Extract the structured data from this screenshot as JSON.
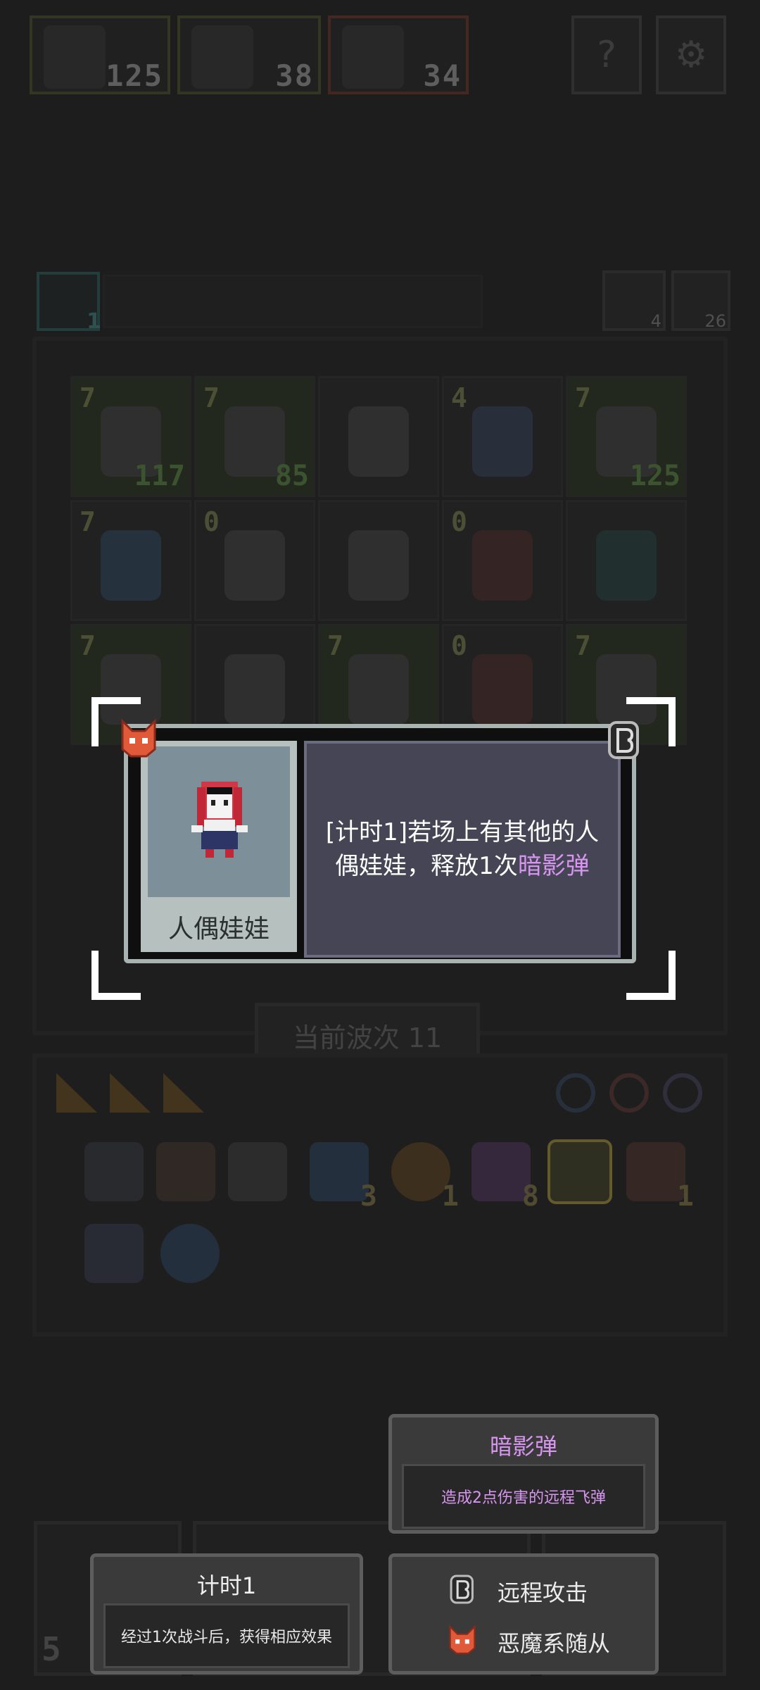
{
  "top_bar": {
    "hero_counts": [
      "125",
      "38",
      "34"
    ],
    "help_label": "?",
    "settings_label": "⚙"
  },
  "status": {
    "clock_value": "1",
    "refresh_count": "4",
    "key_count": "26"
  },
  "board": {
    "cells": [
      {
        "level": "7",
        "hp": "117"
      },
      {
        "level": "7",
        "hp": "85"
      },
      {
        "level": "",
        "hp": ""
      },
      {
        "level": "4",
        "hp": ""
      },
      {
        "level": "7",
        "hp": "125"
      },
      {
        "level": "7",
        "hp": ""
      },
      {
        "level": "0",
        "hp": ""
      },
      {
        "level": "",
        "hp": ""
      },
      {
        "level": "0",
        "hp": ""
      },
      {
        "level": "",
        "hp": ""
      },
      {
        "level": "7",
        "hp": ""
      },
      {
        "level": "",
        "hp": ""
      },
      {
        "level": "7",
        "hp": ""
      },
      {
        "level": "0",
        "hp": ""
      },
      {
        "level": "7",
        "hp": ""
      }
    ],
    "wave_label": "当前波次 11"
  },
  "inventory": {
    "counts": [
      "",
      "",
      "",
      "3",
      "1",
      "8",
      "",
      "1",
      "",
      ""
    ]
  },
  "popup": {
    "unit_name": "人偶娃娃",
    "desc_part1": "[计时1]若场上有其他的人偶娃娃，释放1次",
    "desc_keyword": "暗影弹"
  },
  "tooltips": {
    "shadow": {
      "title": "暗影弹",
      "body": "造成2点伤害的远程飞弹",
      "color": "#d895f0"
    },
    "timer": {
      "title": "计时1",
      "body": "经过1次战斗后，获得相应效果"
    },
    "tags": {
      "ranged": "远程攻击",
      "demon": "恶魔系随从"
    }
  },
  "bottom": {
    "left_number": "5"
  }
}
